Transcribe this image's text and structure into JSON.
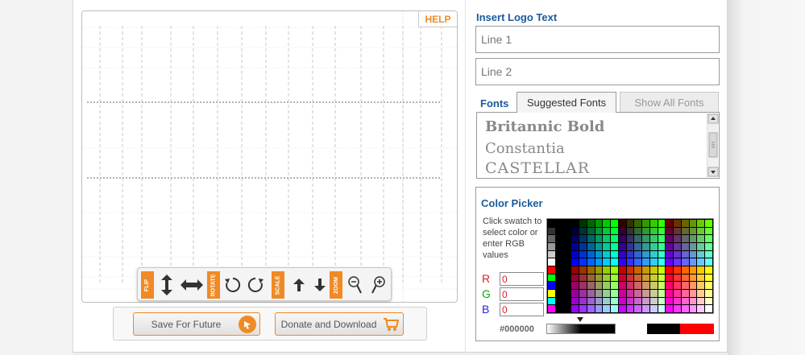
{
  "canvas": {
    "help_label": "HELP"
  },
  "toolbar": {
    "flip_label": "FLIP",
    "rotate_label": "ROTATE",
    "scale_label": "SCALE",
    "zoom_label": "ZOOM"
  },
  "actions": {
    "save_label": "Save For Future",
    "donate_label": "Donate and Download"
  },
  "logo_text": {
    "title": "Insert Logo Text",
    "line1_placeholder": "Line 1",
    "line2_placeholder": "Line 2"
  },
  "fonts": {
    "label": "Fonts",
    "tab_suggested": "Suggested Fonts",
    "tab_all": "Show All Fonts",
    "items": [
      "Britannic Bold",
      "Constantia",
      "CASTELLAR"
    ]
  },
  "color_picker": {
    "title": "Color Picker",
    "instructions": "Click swatch to select color or enter RGB values",
    "r_label": "R",
    "g_label": "G",
    "b_label": "B",
    "r_value": "0",
    "g_value": "0",
    "b_value": "0",
    "hex_value": "#000000",
    "current_color": "#000000",
    "preview_color": "#ff0000"
  },
  "colors": {
    "accent": "#f08a24",
    "title_blue": "#1a5a9a"
  }
}
